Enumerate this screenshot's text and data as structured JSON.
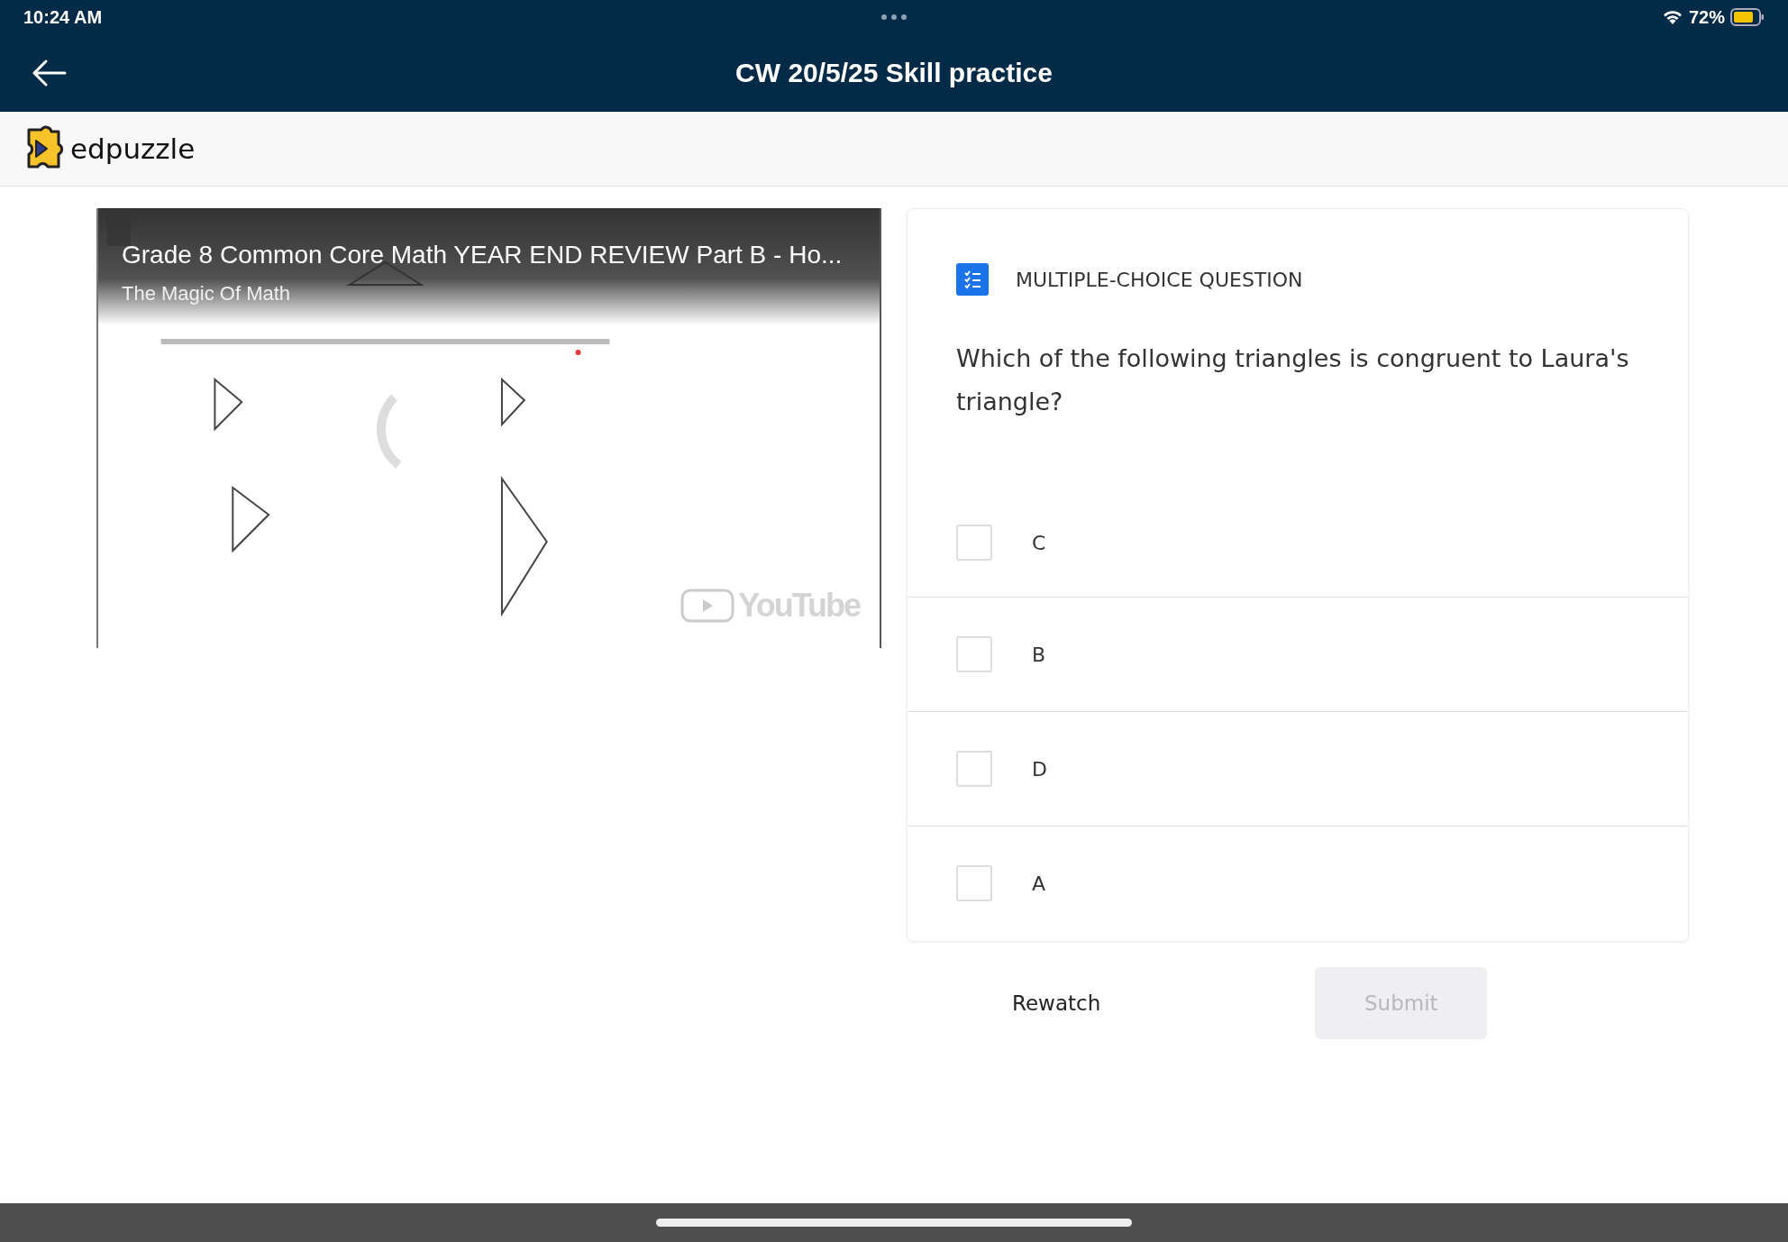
{
  "status_bar": {
    "time": "10:24 AM",
    "battery": "72%"
  },
  "nav_bar": {
    "title": "CW 20/5/25 Skill practice"
  },
  "brand": {
    "name": "edpuzzle"
  },
  "video": {
    "title": "Grade 8 Common Core Math YEAR END REVIEW Part B - Ho...",
    "channel": "The Magic Of Math",
    "logo_text": "YouTube"
  },
  "question": {
    "type_label": "MULTIPLE-CHOICE QUESTION",
    "text": "Which of the following triangles is congruent to Laura's triangle?",
    "options": [
      {
        "label": "C",
        "checked": false
      },
      {
        "label": "B",
        "checked": false
      },
      {
        "label": "D",
        "checked": false
      },
      {
        "label": "A",
        "checked": false
      }
    ]
  },
  "actions": [
    {
      "kind": "text",
      "label": "Rewatch",
      "disabled": false
    },
    {
      "kind": "filled",
      "label": "Submit",
      "disabled": true
    }
  ]
}
